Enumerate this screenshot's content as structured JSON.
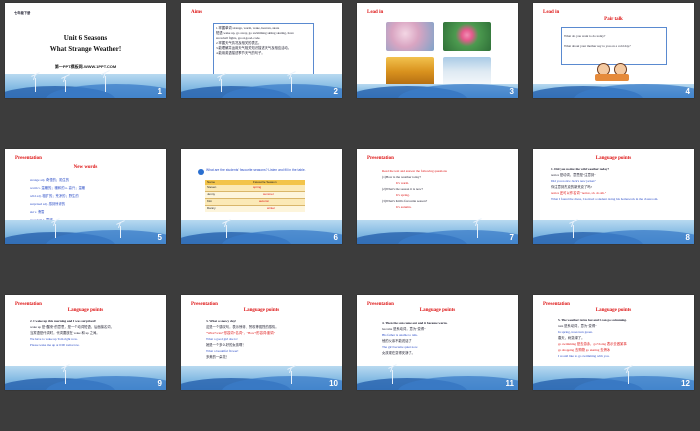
{
  "slides": [
    {
      "num": "1",
      "label": "七年级下册",
      "title1": "Unit 6 Seasons",
      "title2": "What Strange Weather!",
      "link": "第一PPT模板网-WWW.1PPT.COM"
    },
    {
      "num": "2",
      "heading": "Aims",
      "lines": [
        "1.掌握单词 strange, warm, wake, heaven, skate",
        "短语 wake up, go away, go swimming skiing skating, have",
        "snowball fights, good-good-code.",
        "2.掌握天气情况及相关的表达。",
        "3.能理解并运用天气相关知识描述天气及相应活动。",
        "4.能用英语描述季节天气的句子。"
      ]
    },
    {
      "num": "3",
      "heading": "Lead in"
    },
    {
      "num": "4",
      "heading": "Lead in",
      "subtitle": "Pair talk",
      "q1": "What do you want to do today?",
      "q2": "What about your mother say to you on a cold day?"
    },
    {
      "num": "5",
      "heading": "Presentation",
      "subtitle": "New words",
      "words": [
        "strange  adj. 奇怪的；陌生的",
        "warm  v. 温暖的；暖和的  n. 高兴；温暖",
        "wild  adj. 粗犷的；荒凉的；野生的",
        "surprised  adj. 感到惊讶的",
        "ski  v. 滑雪",
        "snowball  n. 雪球"
      ]
    },
    {
      "num": "6",
      "title": "What are the students' favourite seasons? Listen and fill in the table.",
      "headers": [
        "Name",
        "Favourite Season"
      ],
      "rows": [
        [
          "Steven",
          "spring"
        ],
        [
          "Jenny",
          "summer"
        ],
        [
          "Kim",
          "autumn"
        ],
        [
          "Danny",
          "winter"
        ]
      ]
    },
    {
      "num": "7",
      "heading": "Presentation",
      "intro": "Read the text and answer the following questions",
      "q1": "(1)How is the weather today?",
      "a1": "It's warm.",
      "q2": "(2)What's the season it is now?",
      "a2": "It's spring.",
      "q3": "(3)What's Kim's favourite season?",
      "a3": "It's autumn."
    },
    {
      "num": "8",
      "subtitle": "Language points",
      "lines": [
        "1. Did you notice the wild weather today?",
        "notice 是动词，意思是\"注意到\"",
        "Did you notice Jack's new jacket?",
        "你注意到杰克的新夹克了吗?",
        "notice 还可以作名词 \"notice, sb. do sth.\"",
        "What I found the dress, I noticed a student doing his homework in the classroom."
      ]
    },
    {
      "num": "9",
      "heading": "Presentation",
      "subtitle": "Language points",
      "lines": [
        "2. I woke up this morning and I was surprised!",
        "wake up 是\"醒来\"的意思，是一个动词短语，后面接名词，",
        "当宾语是代词时，代词要放在 wake 和 up 之间。",
        "We have to wake up Tom right now.",
        "Please wake me up at 6:00 tomorrow."
      ]
    },
    {
      "num": "10",
      "heading": "Presentation",
      "subtitle": "Language points",
      "lines": [
        "3. What a snowy day!",
        "这是一个感叹句，表示惊讶、赞叹等强烈的感情。",
        "\"What+a/an+形容词+名词\"，\"How+形容词/副词\"",
        "What a good girl she is!",
        "她是一个多么好的女孩啊！",
        "What a beautiful flower!",
        "多美的一朵花！"
      ]
    },
    {
      "num": "11",
      "heading": "Presentation",
      "subtitle": "Language points",
      "lines": [
        "4. Then the sun came out and it became warm.",
        "become 是系动词，意为\"变得\"",
        "His father is unable to talk.",
        "他的父亲不能说话了",
        "The girl became quiet now.",
        "女孩现在变得安静了。"
      ]
    },
    {
      "num": "12",
      "heading": "Presentation",
      "subtitle": "Language points",
      "lines": [
        "5. The weather turns hot and I can go swimming.",
        "turn 是系动词，意为\"变得\"",
        "In spring, trees turn green.",
        "春天，树变绿了。",
        "go swimming 是去游泳，go+doing 表示去做某事",
        "go shopping 去购物 go skating 去滑冰",
        "I would like to go swimming with you."
      ]
    }
  ]
}
